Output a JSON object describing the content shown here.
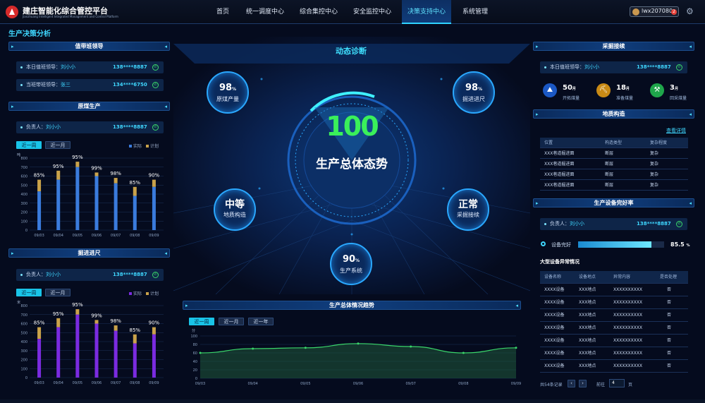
{
  "app": {
    "title": "建庄智能化综合管控平台",
    "subtitle": "Jianzhuang Intelligent Integrated Management and Control Platform"
  },
  "nav": [
    {
      "label": "首页"
    },
    {
      "label": "统一调度中心"
    },
    {
      "label": "综合集控中心"
    },
    {
      "label": "安全监控中心"
    },
    {
      "label": "决策支持中心"
    },
    {
      "label": "系统管理"
    }
  ],
  "user": {
    "name": "lwx207080",
    "badge": "2"
  },
  "page_title": "生产决策分析",
  "left": {
    "duty": {
      "title": "值带班领导",
      "rows": [
        {
          "key": "本日值班领导：",
          "name": "刘小小",
          "phone": "138****8887"
        },
        {
          "key": "当班带班领导：",
          "name": "张三",
          "phone": "134****6750"
        }
      ]
    },
    "coal": {
      "title": "原煤生产",
      "key": "负责人：",
      "name": "刘小小",
      "phone": "138****8887",
      "tabs": [
        "近一周",
        "近一月"
      ],
      "legend": [
        "实际",
        "计划"
      ],
      "unit": "吨"
    },
    "tunnel": {
      "title": "掘进进尺",
      "key": "负责人：",
      "name": "刘小小",
      "phone": "138****8887",
      "tabs": [
        "近一周",
        "近一月"
      ],
      "legend": [
        "实际",
        "计划"
      ],
      "unit": "米"
    }
  },
  "center": {
    "title": "动态诊断",
    "score": "100",
    "score_label": "生产总体态势",
    "metrics": [
      {
        "value": "98",
        "unit": "%",
        "label": "原煤产量"
      },
      {
        "value": "98",
        "unit": "%",
        "label": "掘进进尺"
      },
      {
        "value": "中等",
        "label": "地质构造"
      },
      {
        "value": "正常",
        "label": "采掘接续"
      },
      {
        "value": "90",
        "unit": "%",
        "label": "生产系统"
      }
    ],
    "trend": {
      "title": "生产总体情况趋势",
      "tabs": [
        "近一周",
        "近一月",
        "近一年"
      ],
      "unit": "分"
    }
  },
  "right": {
    "mining": {
      "title": "采掘接续",
      "key": "本日值班领导：",
      "name": "刘小小",
      "phone": "138****8887",
      "stats": [
        {
          "value": "50",
          "unit": "月",
          "label": "开拓煤量"
        },
        {
          "value": "18",
          "unit": "月",
          "label": "准备煤量"
        },
        {
          "value": "3",
          "unit": "月",
          "label": "回采煤量"
        }
      ]
    },
    "geo": {
      "title": "地质构造",
      "link": "查看详情",
      "headers": [
        "位置",
        "构造类型",
        "复杂程度"
      ],
      "rows": [
        [
          "XXX巷道掘进面",
          "断层",
          "复杂"
        ],
        [
          "XXX巷道掘进面",
          "断层",
          "复杂"
        ],
        [
          "XXX巷道掘进面",
          "断层",
          "复杂"
        ],
        [
          "XXX巷道掘进面",
          "断层",
          "复杂"
        ]
      ]
    },
    "equip": {
      "title": "生产设备完好率",
      "key": "负责人：",
      "name": "刘小小",
      "phone": "138****8887",
      "bar_label": "设备完好",
      "bar_value": "85.5",
      "bar_unit": "%"
    },
    "abnormal": {
      "title": "大型设备异常情况",
      "headers": [
        "设备名称",
        "设备地点",
        "异常内容",
        "是否处理"
      ],
      "rows": [
        [
          "XXXX设备",
          "XXX地点",
          "XXXXXXXXXX",
          "否"
        ],
        [
          "XXXX设备",
          "XXX地点",
          "XXXXXXXXXX",
          "否"
        ],
        [
          "XXXX设备",
          "XXX地点",
          "XXXXXXXXXX",
          "否"
        ],
        [
          "XXXX设备",
          "XXX地点",
          "XXXXXXXXXX",
          "否"
        ],
        [
          "XXXX设备",
          "XXX地点",
          "XXXXXXXXXX",
          "否"
        ],
        [
          "XXXX设备",
          "XXX地点",
          "XXXXXXXXXX",
          "否"
        ],
        [
          "XXXX设备",
          "XXX地点",
          "XXXXXXXXXX",
          "否"
        ]
      ]
    },
    "pager": {
      "total": "共54条记录",
      "goto": "前往",
      "page": "4",
      "suffix": "页"
    }
  },
  "colors": {
    "accent": "#3fd7ff",
    "actual_coal": "#3a7bdc",
    "actual_tunnel": "#7a2be0",
    "plan": "#c9a24a",
    "ok": "#3ad56a"
  },
  "chart_data": [
    {
      "type": "bar",
      "title": "原煤生产",
      "categories": [
        "09/03",
        "09/04",
        "09/05",
        "09/06",
        "09/07",
        "09/08",
        "09/09"
      ],
      "series": [
        {
          "name": "实际",
          "values": [
            430,
            560,
            700,
            600,
            520,
            380,
            480
          ]
        },
        {
          "name": "计划",
          "values": [
            560,
            660,
            760,
            640,
            580,
            480,
            560
          ]
        }
      ],
      "data_labels": [
        "85%",
        "95%",
        "95%",
        "99%",
        "98%",
        "85%",
        "90%"
      ],
      "ylabel": "吨",
      "ylim": [
        0,
        800
      ],
      "yticks": [
        0,
        100,
        200,
        300,
        400,
        500,
        600,
        700,
        800
      ]
    },
    {
      "type": "bar",
      "title": "掘进进尺",
      "categories": [
        "09/03",
        "09/04",
        "09/05",
        "09/06",
        "09/07",
        "09/08",
        "09/09"
      ],
      "series": [
        {
          "name": "实际",
          "values": [
            430,
            560,
            700,
            600,
            520,
            380,
            480
          ]
        },
        {
          "name": "计划",
          "values": [
            560,
            660,
            760,
            640,
            580,
            480,
            560
          ]
        }
      ],
      "data_labels": [
        "85%",
        "95%",
        "95%",
        "99%",
        "98%",
        "85%",
        "90%"
      ],
      "ylabel": "米",
      "ylim": [
        0,
        800
      ],
      "yticks": [
        0,
        100,
        200,
        300,
        400,
        500,
        600,
        700,
        800
      ]
    },
    {
      "type": "area",
      "title": "生产总体情况趋势",
      "x": [
        "09/03",
        "09/04",
        "09/05",
        "09/06",
        "09/07",
        "09/08",
        "09/09"
      ],
      "series": [
        {
          "values": [
            60,
            70,
            72,
            82,
            75,
            60,
            72
          ]
        }
      ],
      "ylabel": "分",
      "ylim": [
        0,
        100
      ],
      "yticks": [
        0,
        20,
        40,
        60,
        80,
        100
      ]
    }
  ]
}
